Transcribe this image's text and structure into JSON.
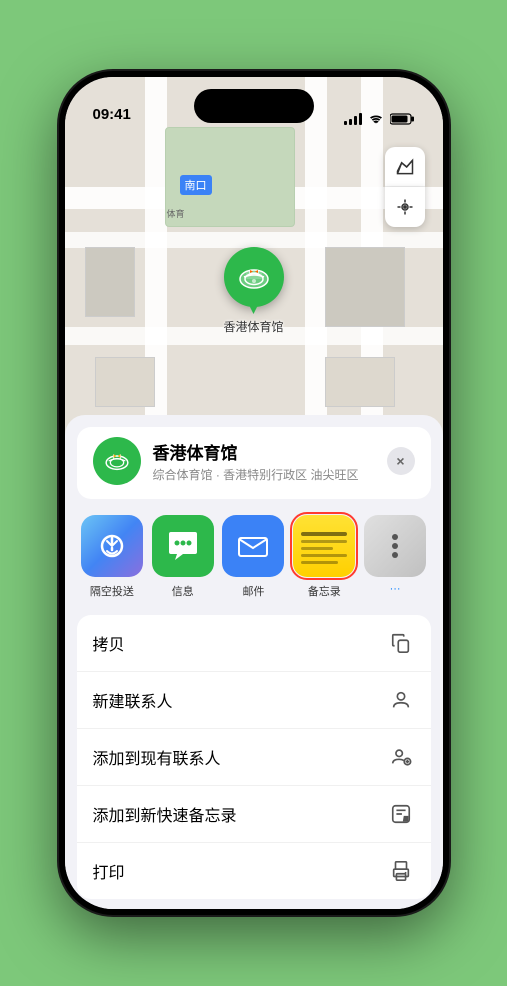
{
  "status_bar": {
    "time": "09:41",
    "location_icon": "▶"
  },
  "map": {
    "label_text": "南口",
    "venue_pin_label": "香港体育馆",
    "map_btn_1": "🗺",
    "map_btn_2": "➤"
  },
  "venue_sheet": {
    "name": "香港体育馆",
    "subtitle": "综合体育馆 · 香港特别行政区 油尖旺区",
    "close_label": "×"
  },
  "share_apps": [
    {
      "label": "隔空投送",
      "type": "airdrop"
    },
    {
      "label": "信息",
      "type": "messages"
    },
    {
      "label": "邮件",
      "type": "mail"
    },
    {
      "label": "备忘录",
      "type": "notes",
      "selected": true
    },
    {
      "label": "更多",
      "type": "more"
    }
  ],
  "action_items": [
    {
      "label": "拷贝",
      "icon": "copy"
    },
    {
      "label": "新建联系人",
      "icon": "person"
    },
    {
      "label": "添加到现有联系人",
      "icon": "person-add"
    },
    {
      "label": "添加到新快速备忘录",
      "icon": "note"
    },
    {
      "label": "打印",
      "icon": "print"
    }
  ]
}
